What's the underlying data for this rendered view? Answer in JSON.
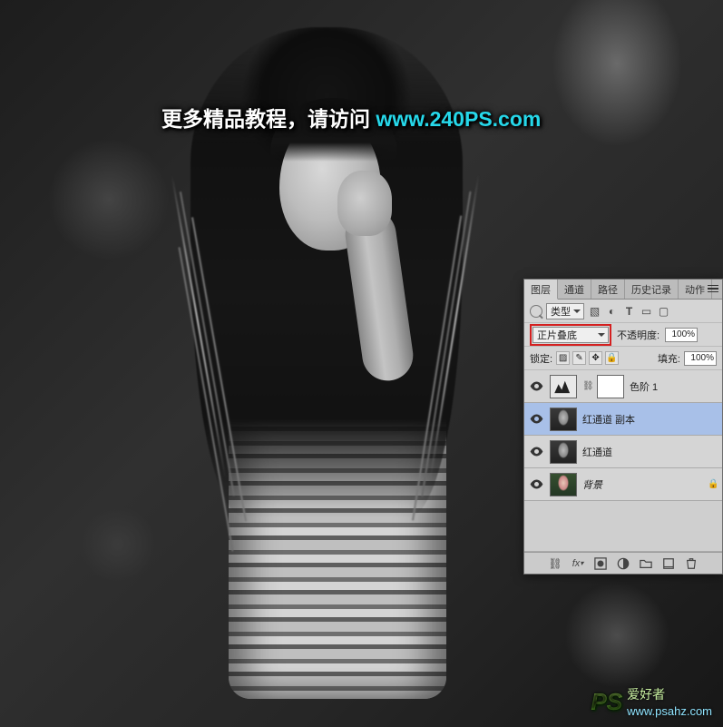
{
  "watermark": {
    "text_prefix": "更多精品教程，请访问 ",
    "url": "www.240PS.com"
  },
  "bottom_watermark": {
    "logo": "PS",
    "label": "爱好者",
    "site": "www.psahz.com"
  },
  "panel": {
    "tabs": [
      "图层",
      "通道",
      "路径",
      "历史记录",
      "动作"
    ],
    "active_tab_index": 0,
    "filter": {
      "kind_label": "类型"
    },
    "blend": {
      "mode": "正片叠底",
      "opacity_label": "不透明度:",
      "opacity_value": "100%"
    },
    "lock": {
      "label": "锁定:",
      "fill_label": "填充:",
      "fill_value": "100%"
    },
    "layers": [
      {
        "visible": true,
        "type": "adjustment",
        "name": "色阶 1",
        "has_mask": true
      },
      {
        "visible": true,
        "type": "photo",
        "name": "红通道 副本",
        "selected": true
      },
      {
        "visible": true,
        "type": "photo",
        "name": "红通道"
      },
      {
        "visible": true,
        "type": "color",
        "name": "背景",
        "locked": true
      }
    ]
  }
}
